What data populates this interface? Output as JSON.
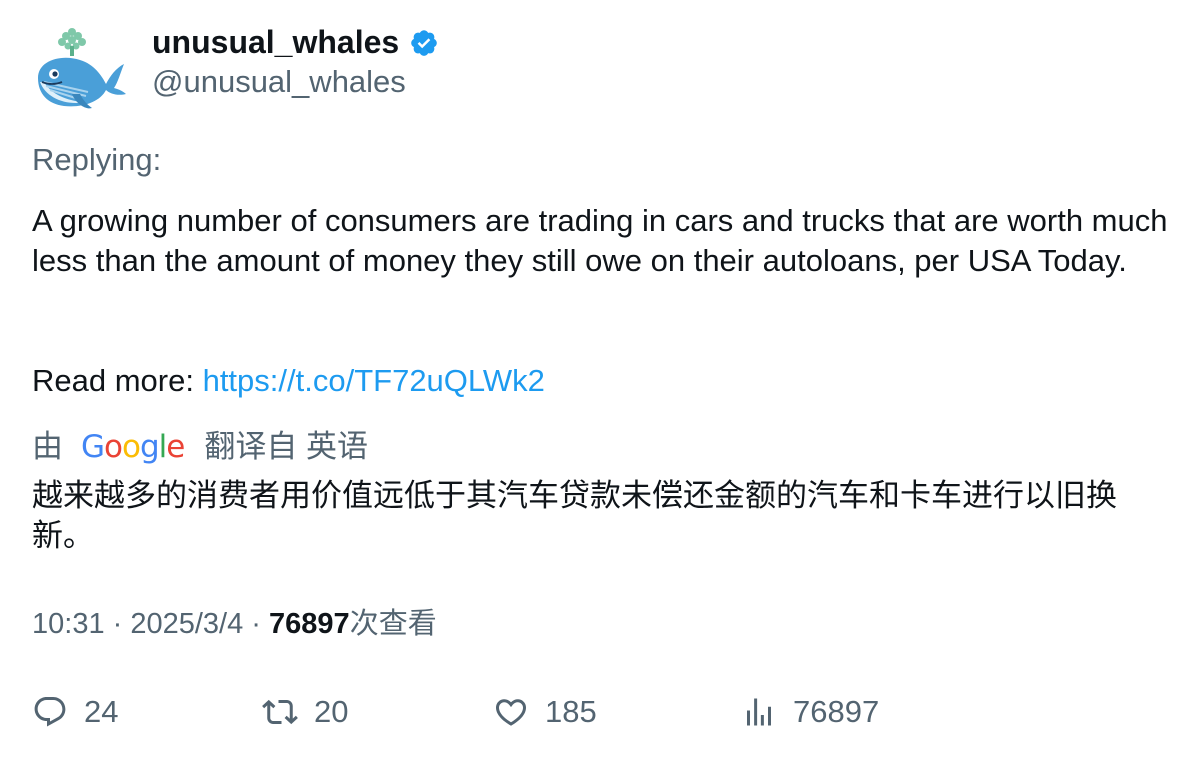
{
  "author": {
    "display_name": "unusual_whales",
    "handle": "@unusual_whales",
    "verified_icon": "verified-badge-icon",
    "avatar_icon": "whale-avatar-icon"
  },
  "reply_label": "Replying:",
  "tweet": {
    "text": "A growing number of consumers are trading in cars and trucks that are worth much less than the amount of money they still owe on their autoloans, per USA Today.",
    "read_more_label": "Read more: ",
    "link": "https://t.co/TF72uQLWk2"
  },
  "translation": {
    "by_label": "由",
    "google_label": "Google",
    "from_label": "翻译自 英语",
    "text": "越来越多的消费者用价值远低于其汽车贷款未偿还金额的汽车和卡车进行以旧换新。"
  },
  "meta": {
    "time": "10:31",
    "separator": " · ",
    "date": "2025/3/4",
    "views": "76897",
    "views_label": "次查看"
  },
  "actions": {
    "replies": "24",
    "retweets": "20",
    "likes": "185",
    "views": "76897"
  },
  "colors": {
    "text": "#0f1419",
    "secondary": "#536471",
    "link": "#1d9bf0",
    "verified": "#1d9bf0"
  }
}
